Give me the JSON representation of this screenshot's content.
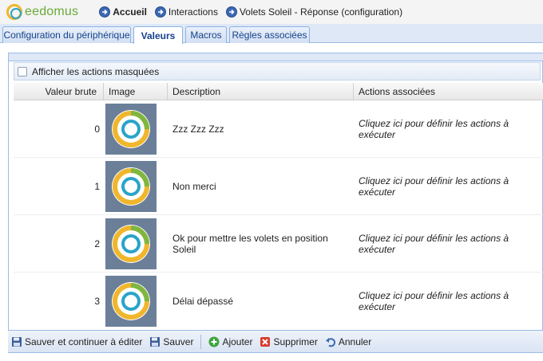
{
  "app": {
    "logo_text": "eedomus"
  },
  "breadcrumb": [
    {
      "label": "Accueil",
      "icon": "arrow-right-circle-icon"
    },
    {
      "label": "Interactions",
      "icon": "arrow-right-circle-icon"
    },
    {
      "label": "Volets Soleil - Réponse (configuration)",
      "icon": "arrow-right-circle-icon"
    }
  ],
  "tabs": [
    {
      "label": "Configuration du périphérique",
      "active": false
    },
    {
      "label": "Valeurs",
      "active": true
    },
    {
      "label": "Macros",
      "active": false
    },
    {
      "label": "Règles associées",
      "active": false
    }
  ],
  "options": {
    "show_hidden_label": "Afficher les actions masquées",
    "show_hidden_checked": false
  },
  "grid": {
    "columns": [
      "Valeur brute",
      "Image",
      "Description",
      "Actions associées"
    ],
    "rows": [
      {
        "value": "0",
        "description": "Zzz Zzz Zzz",
        "action": "Cliquez ici pour définir les actions à exécuter"
      },
      {
        "value": "1",
        "description": "Non merci",
        "action": "Cliquez ici pour définir les actions à exécuter"
      },
      {
        "value": "2",
        "description": "Ok pour mettre les volets en position Soleil",
        "action": "Cliquez ici pour définir les actions à exécuter"
      },
      {
        "value": "3",
        "description": "Délai dépassé",
        "action": "Cliquez ici pour définir les actions à exécuter"
      }
    ]
  },
  "toolbar": {
    "save_continue_label": "Sauver et continuer à éditer",
    "save_label": "Sauver",
    "add_label": "Ajouter",
    "delete_label": "Supprimer",
    "cancel_label": "Annuler"
  },
  "colors": {
    "accent_blue": "#15428b",
    "logo_green": "#6aaa38",
    "ring_yellow": "#f0b62c",
    "ring_cyan": "#2aa4c8",
    "thumb_bg": "#6b7f99"
  }
}
